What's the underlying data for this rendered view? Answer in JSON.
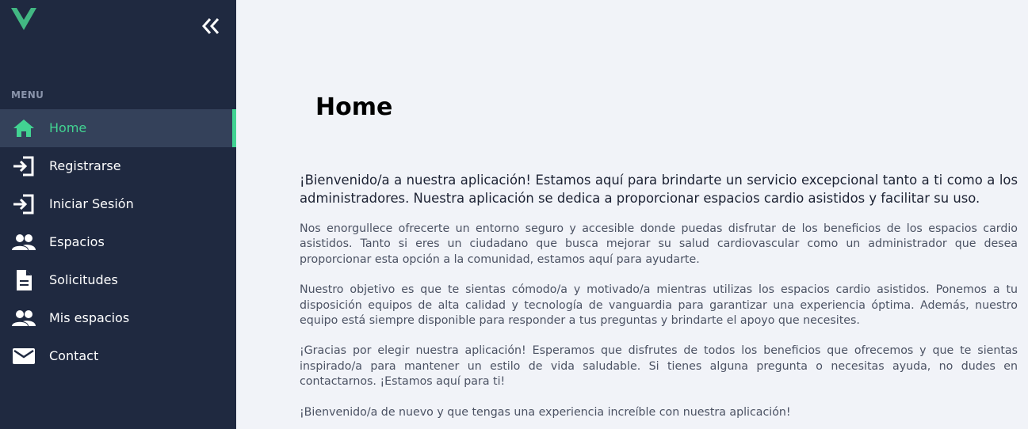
{
  "sidebar": {
    "menu_heading": "MENU",
    "accent_color": "#42d392",
    "background_color": "#1f2940",
    "items": [
      {
        "label": "Home",
        "icon": "home-icon",
        "active": true
      },
      {
        "label": "Registrarse",
        "icon": "login-icon",
        "active": false
      },
      {
        "label": "Iniciar Sesión",
        "icon": "login-icon",
        "active": false
      },
      {
        "label": "Espacios",
        "icon": "people-icon",
        "active": false
      },
      {
        "label": "Solicitudes",
        "icon": "document-icon",
        "active": false
      },
      {
        "label": "Mis espacios",
        "icon": "people-icon",
        "active": false
      },
      {
        "label": "Contact",
        "icon": "mail-icon",
        "active": false
      }
    ]
  },
  "main": {
    "title": "Home",
    "intro": "¡Bienvenido/a a nuestra aplicación! Estamos aquí para brindarte un servicio excepcional tanto a ti como a los administradores. Nuestra aplicación se dedica a proporcionar espacios cardio asistidos y facilitar su uso.",
    "paragraphs": [
      "Nos enorgullece ofrecerte un entorno seguro y accesible donde puedas disfrutar de los beneficios de los espacios cardio asistidos. Tanto si eres un ciudadano que busca mejorar su salud cardiovascular como un administrador que desea proporcionar esta opción a la comunidad, estamos aquí para ayudarte.",
      "Nuestro objetivo es que te sientas cómodo/a y motivado/a mientras utilizas los espacios cardio asistidos. Ponemos a tu disposición equipos de alta calidad y tecnología de vanguardia para garantizar una experiencia óptima. Además, nuestro equipo está siempre disponible para responder a tus preguntas y brindarte el apoyo que necesites.",
      "¡Gracias por elegir nuestra aplicación! Esperamos que disfrutes de todos los beneficios que ofrecemos y que te sientas inspirado/a para mantener un estilo de vida saludable. Si tienes alguna pregunta o necesitas ayuda, no dudes en contactarnos. ¡Estamos aquí para ti!",
      "¡Bienvenido/a de nuevo y que tengas una experiencia increíble con nuestra aplicación!"
    ]
  }
}
